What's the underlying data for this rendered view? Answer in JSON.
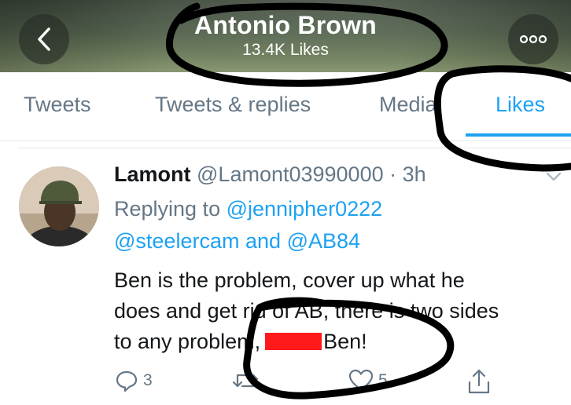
{
  "header": {
    "title": "Antonio Brown",
    "subtitle": "13.4K Likes",
    "back_icon": "chevron-left-icon",
    "more_icon": "ellipsis-icon"
  },
  "tabs": [
    {
      "label": "Tweets",
      "active": false
    },
    {
      "label": "Tweets & replies",
      "active": false
    },
    {
      "label": "Media",
      "active": false
    },
    {
      "label": "Likes",
      "active": true
    }
  ],
  "tweet": {
    "author_name": "Lamont",
    "author_handle": "@Lamont03990000",
    "separator": "·",
    "time": "3h",
    "replying_prefix": "Replying to",
    "mentions": [
      "@jennipher0222",
      "@steelercam",
      "@AB84"
    ],
    "mention_joiner": "and",
    "text_lines": [
      "Ben is the problem, cover up what he",
      "does and get rid of AB, there is two sides",
      "to any problem,",
      "Ben!"
    ],
    "actions": {
      "reply_count": "3",
      "retweet_count": "",
      "like_count": "5"
    }
  },
  "colors": {
    "accent": "#1da1f2",
    "muted": "#657786",
    "text": "#14171a",
    "redaction": "#ff1a1a"
  }
}
